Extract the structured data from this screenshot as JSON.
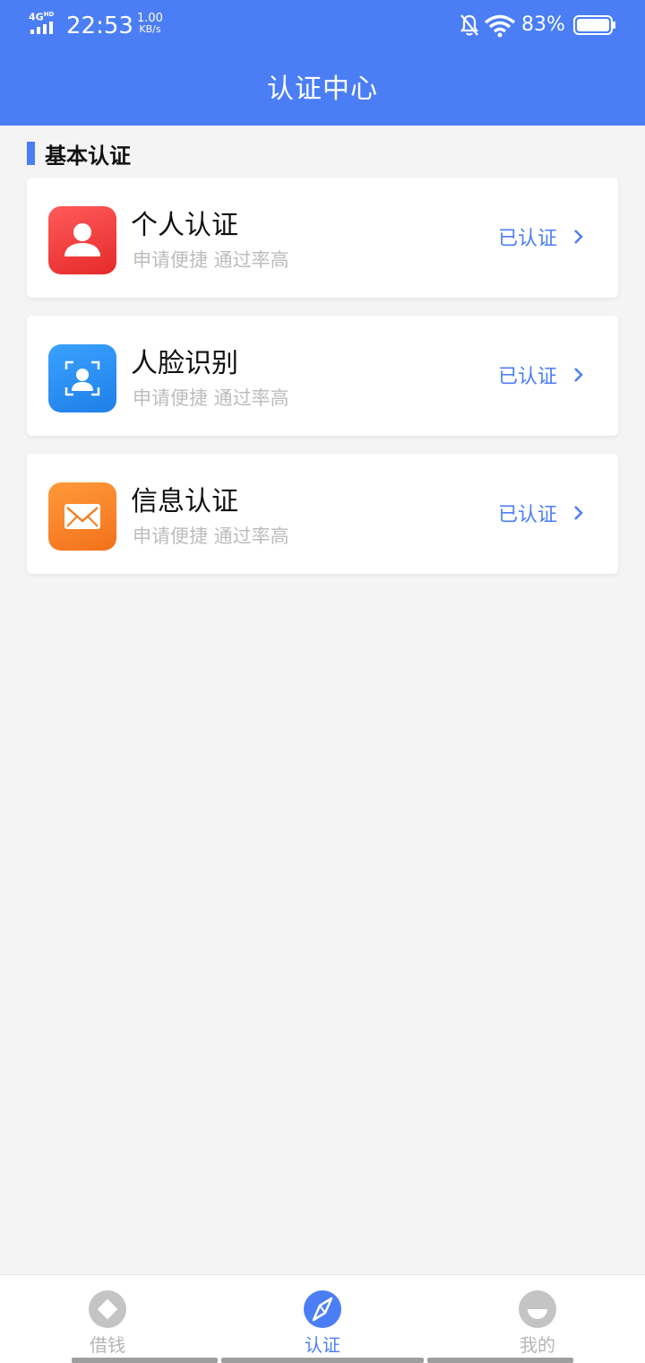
{
  "status_bar": {
    "network": "4G",
    "network_sup": "HD",
    "time": "22:53",
    "speed_value": "1.00",
    "speed_unit": "KB/s",
    "battery": "83%",
    "icons": [
      "signal-icon",
      "bell-off-icon",
      "wifi-icon",
      "battery-icon"
    ]
  },
  "header": {
    "title": "认证中心"
  },
  "section": {
    "title": "基本认证"
  },
  "cards": [
    {
      "title": "个人认证",
      "subtitle": "申请便捷 通过率高",
      "status": "已认证",
      "icon": "person-icon",
      "icon_color": "#f03c3c"
    },
    {
      "title": "人脸识别",
      "subtitle": "申请便捷 通过率高",
      "status": "已认证",
      "icon": "face-scan-icon",
      "icon_color": "#2f8ff0"
    },
    {
      "title": "信息认证",
      "subtitle": "申请便捷 通过率高",
      "status": "已认证",
      "icon": "envelope-icon",
      "icon_color": "#f57e20"
    }
  ],
  "tabbar": {
    "tabs": [
      {
        "label": "借钱",
        "icon": "diamond-icon",
        "active": false
      },
      {
        "label": "认证",
        "icon": "compass-icon",
        "active": true
      },
      {
        "label": "我的",
        "icon": "profile-icon",
        "active": false
      }
    ]
  },
  "colors": {
    "primary": "#4b7ef5",
    "background": "#f4f4f4",
    "subtitle": "#bdbdbd"
  }
}
